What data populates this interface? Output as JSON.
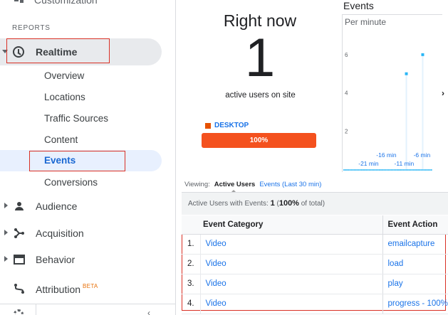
{
  "sidebar": {
    "top_item": "Customization",
    "section_label": "REPORTS",
    "realtime": "Realtime",
    "sub_items": [
      "Overview",
      "Locations",
      "Traffic Sources",
      "Content",
      "Events",
      "Conversions"
    ],
    "main_items": [
      "Audience",
      "Acquisition",
      "Behavior",
      "Attribution"
    ],
    "beta_badge": "BETA"
  },
  "overview": {
    "title": "Right now",
    "count": "1",
    "subtitle": "active users on site",
    "device_label": "DESKTOP",
    "device_percent_label": "100%",
    "device_share": 100,
    "device_color": "#f4511e"
  },
  "chart_data": {
    "type": "bar",
    "title": "Events",
    "subtitle": "Per minute",
    "y_ticks": [
      "6",
      "4",
      "2"
    ],
    "ylim": [
      0,
      7
    ],
    "x_ticks": [
      "-21 min",
      "-16 min",
      "-11 min",
      "-6 min"
    ],
    "series": [
      {
        "values": [
          0,
          0,
          0,
          0,
          0,
          0,
          0,
          0,
          0,
          0,
          0,
          0,
          0,
          0,
          0,
          0,
          0,
          0,
          0,
          0,
          0,
          0,
          0,
          0,
          0,
          0,
          0,
          0,
          0,
          0,
          0,
          0,
          0,
          0,
          0,
          0,
          0,
          0,
          0,
          0,
          0,
          0,
          5,
          0,
          0,
          0,
          0,
          0,
          0,
          0,
          0,
          0,
          0,
          6,
          0,
          0,
          0,
          0,
          0,
          0
        ]
      }
    ],
    "color": "#4fc3f7",
    "grid": false
  },
  "tabs": {
    "viewing_label": "Viewing:",
    "active": "Active Users",
    "other": "Events (Last 30 min)"
  },
  "summary": {
    "prefix": "Active Users with Events:",
    "count": "1",
    "percent": "100%",
    "suffix": "of total)"
  },
  "table": {
    "headers": [
      "Event Category",
      "Event Action"
    ],
    "rows": [
      {
        "num": "1.",
        "category": "Video",
        "action": "emailcapture"
      },
      {
        "num": "2.",
        "category": "Video",
        "action": "load"
      },
      {
        "num": "3.",
        "category": "Video",
        "action": "play"
      },
      {
        "num": "4.",
        "category": "Video",
        "action": "progress - 100%"
      }
    ]
  }
}
